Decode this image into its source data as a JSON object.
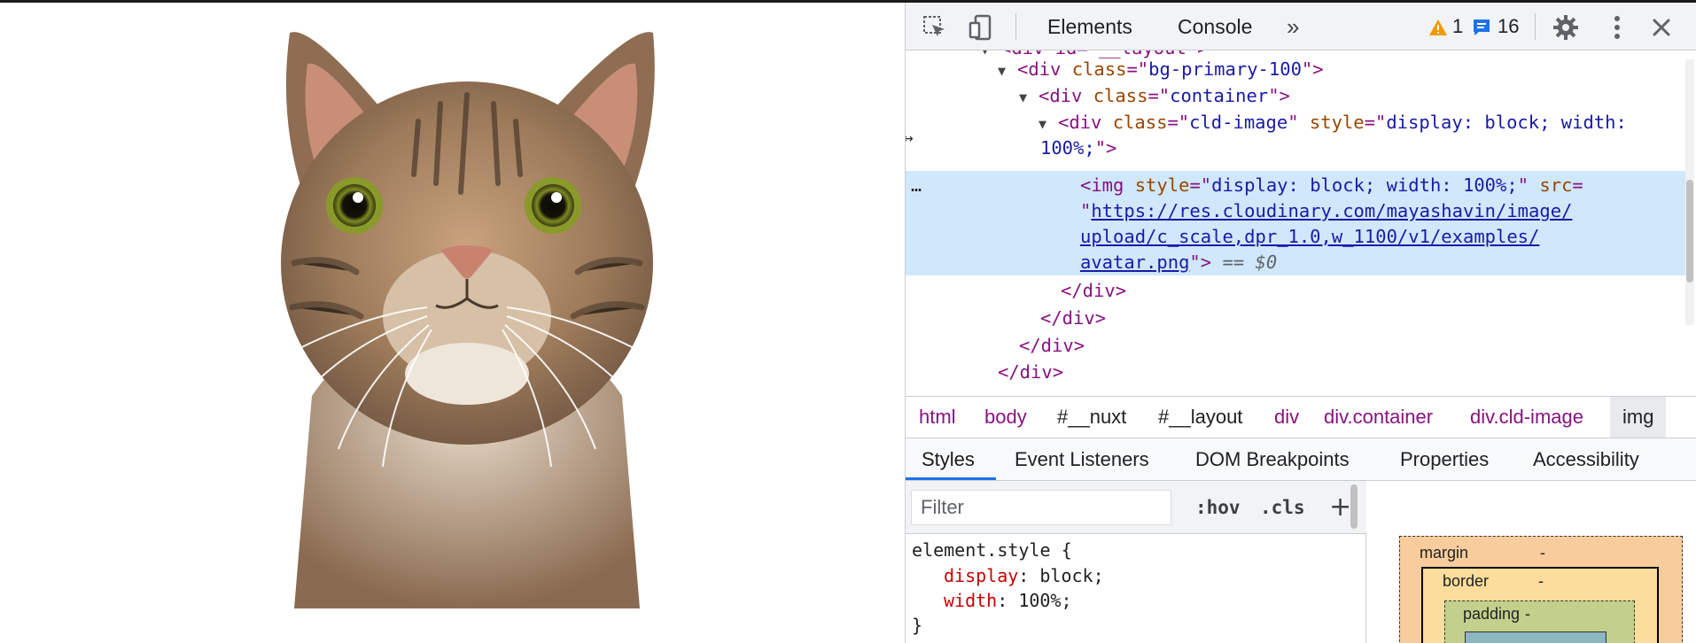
{
  "devtools": {
    "tabs": {
      "elements": "Elements",
      "console": "Console",
      "more": "»"
    },
    "warnings_count": "1",
    "messages_count": "16",
    "colors": {
      "warning": "#f29900",
      "message": "#1a73e8",
      "selection": "#cfe8fc"
    }
  },
  "dom": {
    "line0": {
      "text": "<div id=\"__layout\">"
    },
    "line1": {
      "tag_open": "<div ",
      "attr": "class",
      "eq": "=\"",
      "val": "bg-primary-100",
      "close": "\">"
    },
    "line2": {
      "tag_open": "<div ",
      "attr": "class",
      "eq": "=\"",
      "val": "container",
      "close": "\">"
    },
    "line3": {
      "tag_open": "<div ",
      "attr1": "class",
      "val1": "cld-image",
      "attr2": "style",
      "val2": "display: block; width:"
    },
    "line4": {
      "val": "100%;",
      "close": "\">"
    },
    "sel1": {
      "tag_open": "<img ",
      "attr1": "style",
      "val1": "display: block; width: 100%;",
      "attr2": "src",
      "eq2": "="
    },
    "sel2": {
      "link": "https://res.cloudinary.com/mayashavin/image/"
    },
    "sel3": {
      "link": "upload/c_scale,dpr_1.0,w_1100/v1/examples/"
    },
    "sel4": {
      "link": "avatar.png",
      "close": "\">",
      "eq": " == ",
      "ref": "$0"
    },
    "close1": "</div>",
    "close2": "</div>",
    "close3": "</div>",
    "close4": "</div>",
    "ellipsis": "…"
  },
  "breadcrumbs": [
    "html",
    "body",
    "#__nuxt",
    "#__layout",
    "div",
    "div.container",
    "div.cld-image",
    "img"
  ],
  "subtabs": [
    "Styles",
    "Event Listeners",
    "DOM Breakpoints",
    "Properties",
    "Accessibility"
  ],
  "styles": {
    "filter_placeholder": "Filter",
    "hov": ":hov",
    "cls": ".cls",
    "add": "+",
    "selector": "element.style {",
    "rules": [
      {
        "prop": "display",
        "value": "block;"
      },
      {
        "prop": "width",
        "value": "100%;"
      }
    ],
    "close_brace": "}"
  },
  "boxmodel": {
    "margin_label": "margin",
    "margin_value": "-",
    "border_label": "border",
    "border_value": "-",
    "padding_label": "padding",
    "padding_value": "-"
  }
}
